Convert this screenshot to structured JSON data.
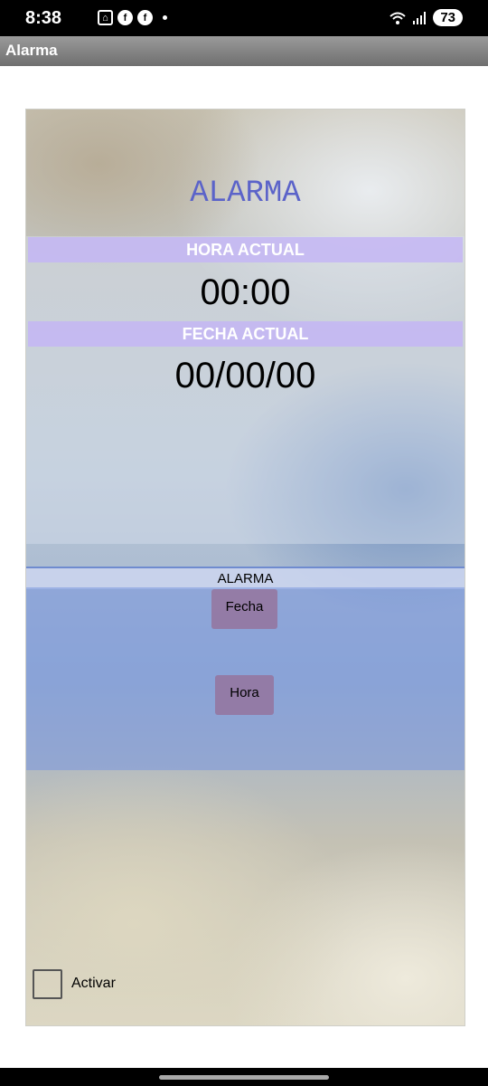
{
  "status_bar": {
    "time": "8:38",
    "battery": "73",
    "icons": [
      "home-icon",
      "facebook-icon",
      "facebook-icon",
      "dot-icon",
      "wifi-icon",
      "signal-icon",
      "battery-icon"
    ]
  },
  "app_bar": {
    "title": "Alarma"
  },
  "main": {
    "title": "ALARMA",
    "current_time_label": "HORA ACTUAL",
    "current_time_value": "00:00",
    "current_date_label": "FECHA ACTUAL",
    "current_date_value": "00/00/00",
    "alarm_section_label": "ALARMA",
    "date_button": "Fecha",
    "time_button": "Hora",
    "activate_label": "Activar"
  },
  "colors": {
    "title": "#5b63c9",
    "label_bar": "#c4b6f4",
    "alarm_area": "#7896de",
    "buttons": "#966e96"
  }
}
